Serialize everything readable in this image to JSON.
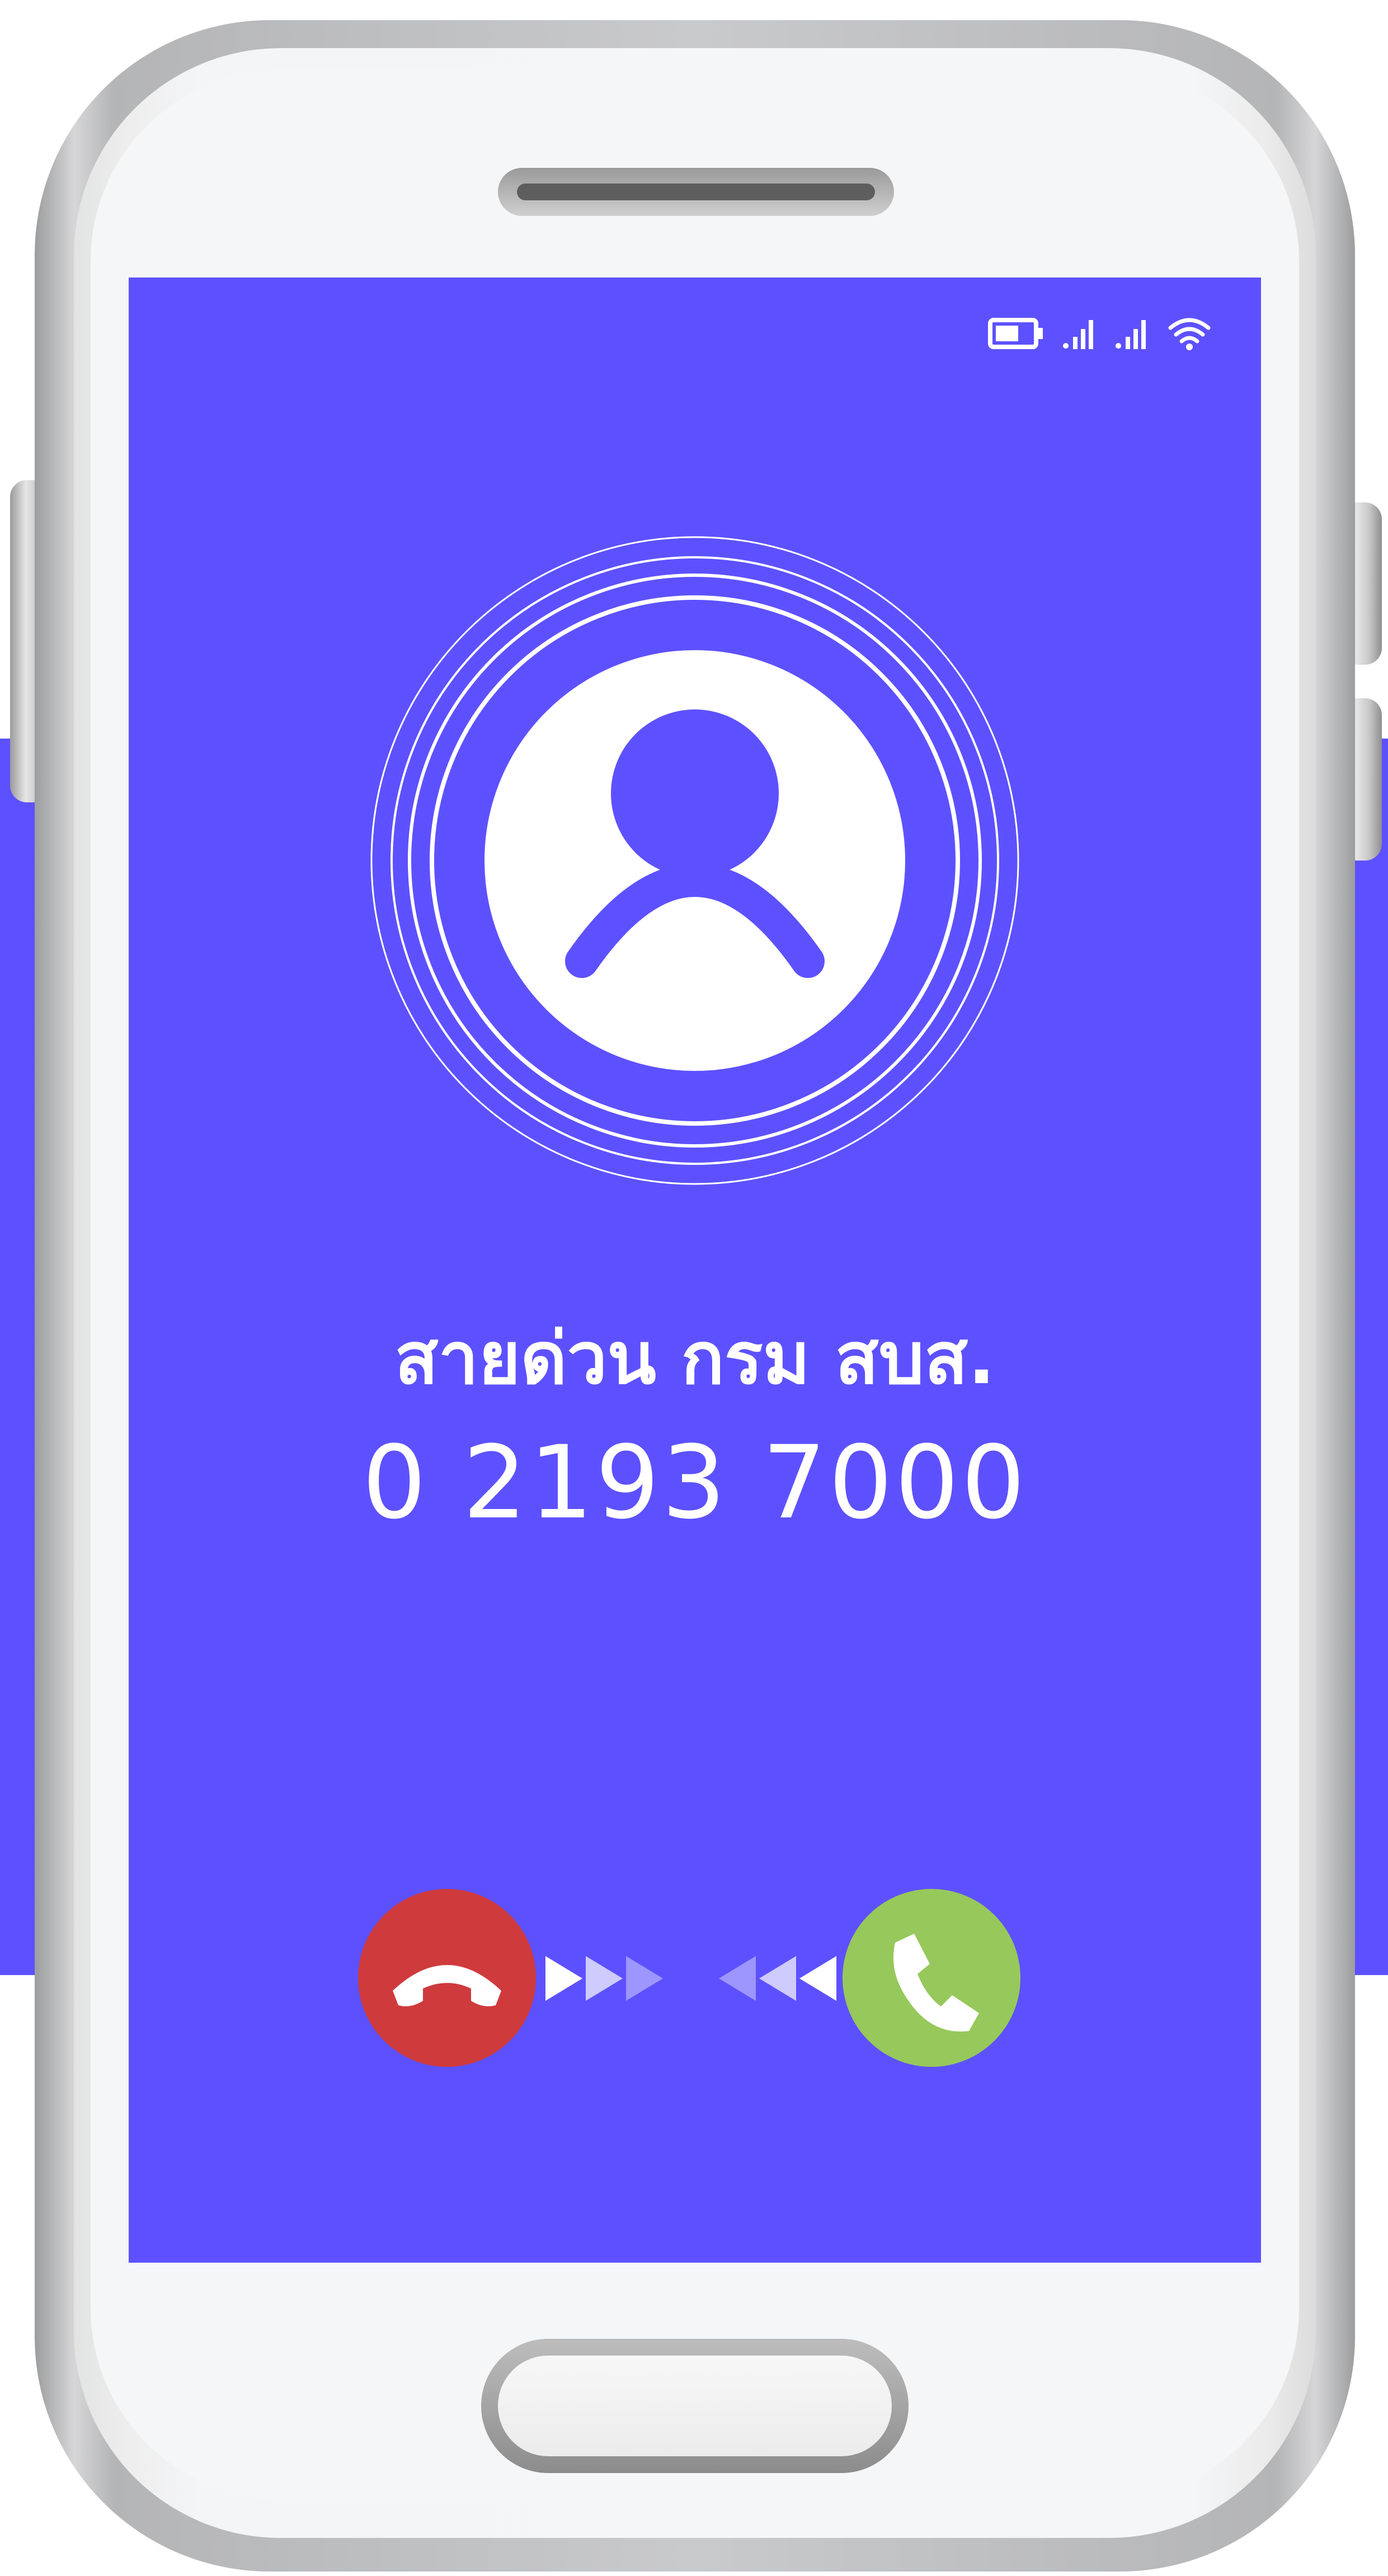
{
  "status_bar": {
    "icons": [
      "battery-icon",
      "cellular-signal-icon",
      "cellular-signal-icon",
      "wifi-icon"
    ]
  },
  "caller": {
    "name": "สายด่วน กรม สบส.",
    "number": "0 2193 7000"
  },
  "actions": {
    "decline_icon": "phone-hangup-icon",
    "accept_icon": "phone-answer-icon"
  },
  "colors": {
    "screen": "#5d51ff",
    "decline": "#cf3a3d",
    "accept": "#97c85b",
    "text": "#ffffff"
  }
}
